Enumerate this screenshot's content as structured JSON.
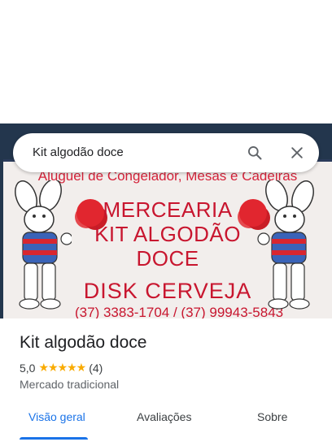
{
  "search": {
    "query": "Kit algodão doce"
  },
  "photo": {
    "sign_line1": "Aluguel de Congelador, Mesas e Cadeiras",
    "title_line1": "MERCEARIA",
    "title_line2": "KIT ALGODÃO",
    "title_line3": "DOCE",
    "subtitle": "DISK CERVEJA",
    "phones": "(37) 3383-1704 / (37) 99943-5843"
  },
  "place": {
    "name": "Kit algodão doce",
    "rating": "5,0",
    "stars": "★★★★★",
    "review_count": "(4)",
    "category": "Mercado tradicional"
  },
  "tabs": [
    {
      "label": "Visão geral"
    },
    {
      "label": "Avaliações"
    },
    {
      "label": "Sobre"
    }
  ],
  "colors": {
    "accent": "#1a73e8",
    "star": "#f9ab00",
    "sign_red": "#c8162f"
  }
}
